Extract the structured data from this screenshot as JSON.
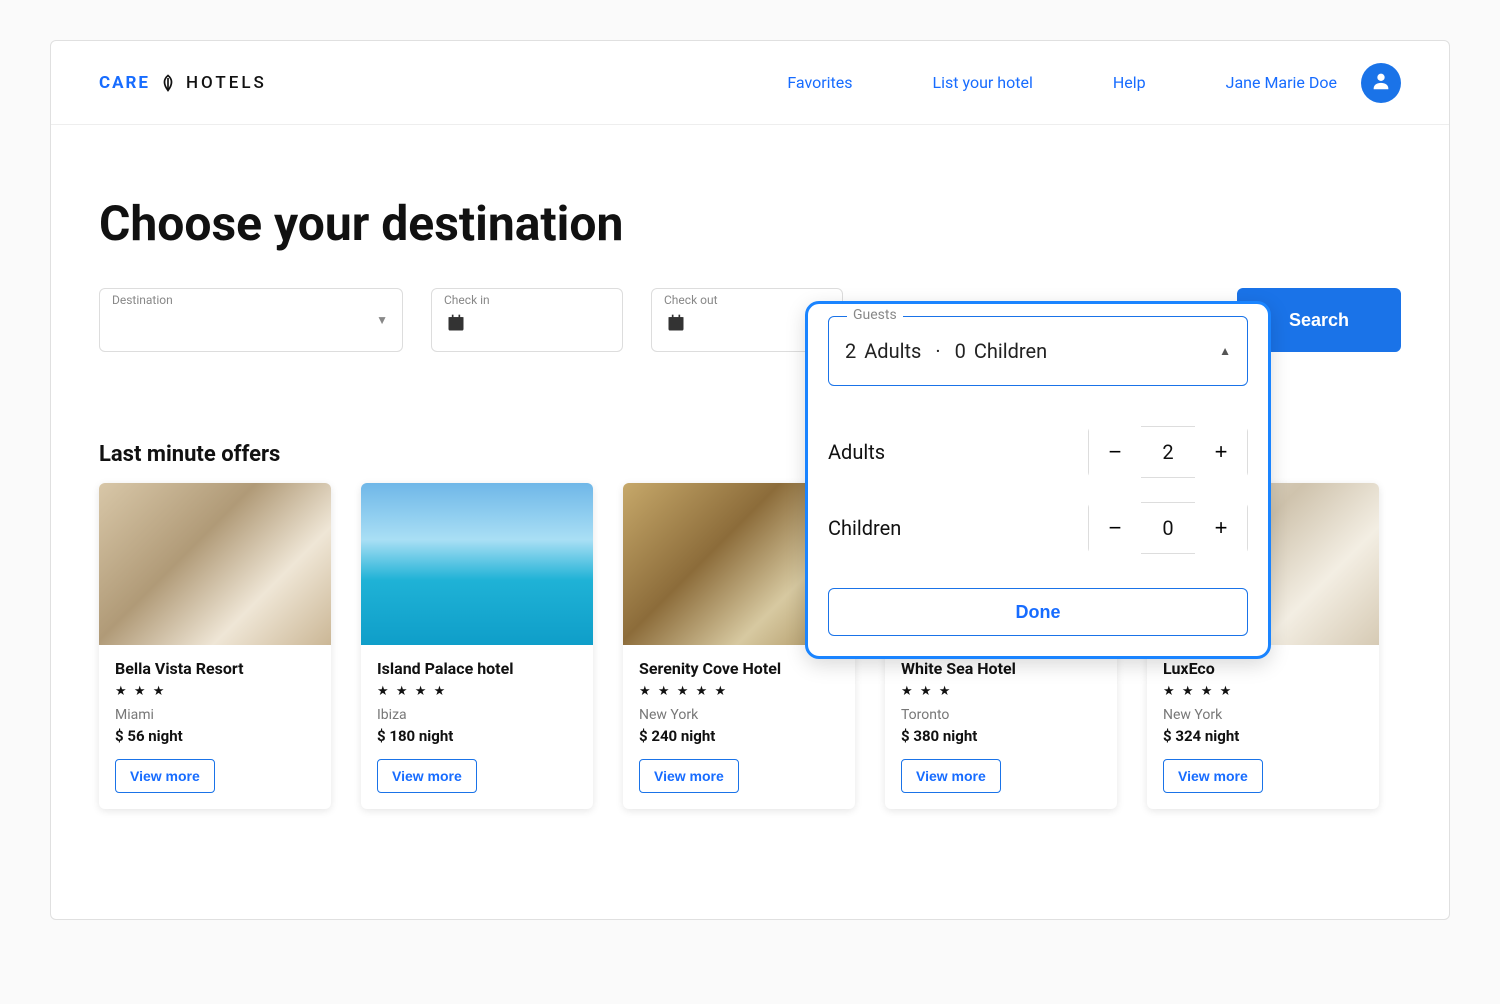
{
  "brand": {
    "care": "CARE",
    "hotels": "HOTELS"
  },
  "nav": {
    "favorites": "Favorites",
    "list_hotel": "List your hotel",
    "help": "Help",
    "user_name": "Jane Marie Doe"
  },
  "search": {
    "title": "Choose your destination",
    "destination_label": "Destination",
    "checkin_label": "Check in",
    "checkout_label": "Check out",
    "search_button": "Search"
  },
  "guests": {
    "label": "Guests",
    "summary_adults_count": "2",
    "summary_adults_word": "Adults",
    "summary_dot": "·",
    "summary_children_count": "0",
    "summary_children_word": "Children",
    "adults_label": "Adults",
    "adults_value": "2",
    "children_label": "Children",
    "children_value": "0",
    "done": "Done"
  },
  "offers": {
    "heading": "Last minute offers",
    "view_more": "View more",
    "items": [
      {
        "title": "Bella Vista Resort",
        "stars": "★ ★ ★",
        "city": "Miami",
        "price": "$ 56 night"
      },
      {
        "title": "Island Palace hotel",
        "stars": "★ ★ ★ ★",
        "city": "Ibiza",
        "price": "$ 180 night"
      },
      {
        "title": "Serenity Cove Hotel",
        "stars": "★ ★ ★ ★ ★",
        "city": "New York",
        "price": "$ 240 night"
      },
      {
        "title": "White Sea Hotel",
        "stars": "★ ★ ★",
        "city": "Toronto",
        "price": "$ 380 night"
      },
      {
        "title": "LuxEco",
        "stars": "★ ★ ★ ★",
        "city": "New York",
        "price": "$ 324 night"
      }
    ]
  }
}
